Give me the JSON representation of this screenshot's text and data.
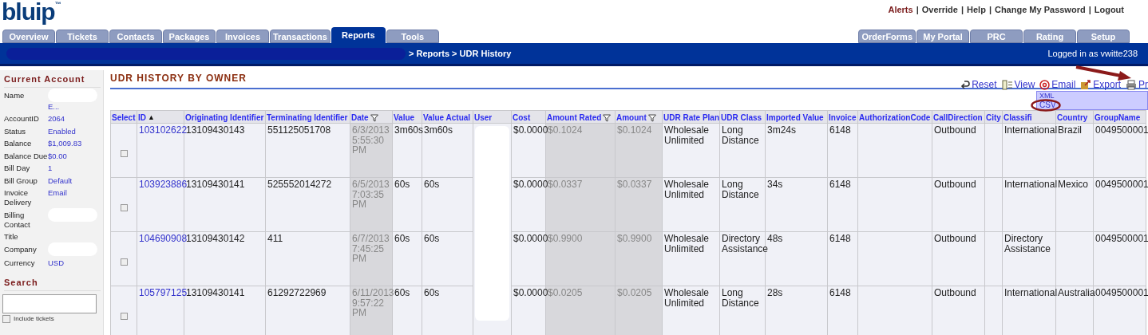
{
  "logo": {
    "text": "bluip",
    "tm": "™"
  },
  "top_links": {
    "separator": "|",
    "items": [
      "Alerts",
      "Override",
      "Help",
      "Change My Password",
      "Logout"
    ]
  },
  "tabs_left": [
    {
      "label": "Overview",
      "selected": false
    },
    {
      "label": "Tickets",
      "selected": false
    },
    {
      "label": "Contacts",
      "selected": false
    },
    {
      "label": "Packages",
      "selected": false
    },
    {
      "label": "Invoices",
      "selected": false
    },
    {
      "label": "Transactions",
      "selected": false
    },
    {
      "label": "Reports",
      "selected": true
    },
    {
      "label": "Tools",
      "selected": false
    }
  ],
  "tabs_right": [
    {
      "label": "OrderForms",
      "selected": false
    },
    {
      "label": "My Portal",
      "selected": false
    },
    {
      "label": "PRC",
      "selected": false
    },
    {
      "label": "Rating",
      "selected": false
    },
    {
      "label": "Setup",
      "selected": false
    }
  ],
  "breadcrumb": "> Reports > UDR History",
  "logged_in": "Logged in as vwitte238",
  "sidebar": {
    "title": "Current Account",
    "fields": [
      {
        "label": "Name",
        "value": "E...",
        "redacted": true
      },
      {
        "label": "AccountID",
        "value": "2064",
        "redacted": false
      },
      {
        "label": "Status",
        "value": "Enabled",
        "redacted": false
      },
      {
        "label": "Balance",
        "value": "$1,009.83",
        "redacted": false
      },
      {
        "label": "Balance Due",
        "value": "$0.00",
        "redacted": false
      },
      {
        "label": "Bill Day",
        "value": "1",
        "redacted": false
      },
      {
        "label": "Bill Group",
        "value": "Default",
        "redacted": false
      },
      {
        "label": "Invoice Delivery",
        "value": "Email",
        "redacted": false
      },
      {
        "label": "Billing Contact",
        "redacted": true
      },
      {
        "label": "Title",
        "redacted": false
      },
      {
        "label": "Company",
        "redacted": true
      },
      {
        "label": "Currency",
        "value": "USD",
        "redacted": false
      }
    ],
    "search_title": "Search",
    "include_label": "Include tickets",
    "include_checked": false
  },
  "page_title": "UDR HISTORY BY OWNER",
  "toolbar": [
    {
      "kind": "reset",
      "label": "Reset"
    },
    {
      "kind": "view",
      "label": "View"
    },
    {
      "kind": "email",
      "label": "Email"
    },
    {
      "kind": "export",
      "label": "Export"
    },
    {
      "kind": "print",
      "label": "Pr"
    }
  ],
  "export_menu": [
    "XML",
    "CSV"
  ],
  "table": {
    "columns": [
      {
        "label": "Select",
        "kind": "check"
      },
      {
        "label": "ID",
        "kind": "link",
        "sort": "▲"
      },
      {
        "label": "Originating Identifier",
        "kind": "text"
      },
      {
        "label": "Terminating Identifier",
        "kind": "text"
      },
      {
        "label": "Date",
        "kind": "shaded",
        "filter": true
      },
      {
        "label": "Value",
        "kind": "text"
      },
      {
        "label": "Value Actual",
        "kind": "text"
      },
      {
        "label": "User",
        "kind": "redacted"
      },
      {
        "label": "Cost",
        "kind": "text"
      },
      {
        "label": "Amount Rated",
        "kind": "shaded",
        "filter": true
      },
      {
        "label": "Amount",
        "kind": "shaded",
        "filter": true
      },
      {
        "label": "UDR Rate Plan",
        "kind": "text"
      },
      {
        "label": "UDR Class",
        "kind": "text"
      },
      {
        "label": "Imported Value",
        "kind": "text"
      },
      {
        "label": "Invoice",
        "kind": "text"
      },
      {
        "label": "AuthorizationCode",
        "kind": "text"
      },
      {
        "label": "CallDirection",
        "kind": "text"
      },
      {
        "label": "City",
        "kind": "text"
      },
      {
        "label": "Classifi",
        "kind": "text"
      },
      {
        "label": "Country",
        "kind": "text"
      },
      {
        "label": "GroupName",
        "kind": "text"
      }
    ],
    "rows": [
      {
        "selected": false,
        "cells": [
          "",
          "103102622",
          "13109430143",
          "551125051708",
          "6/3/2013 5:55:30 PM",
          "3m60s",
          "3m60s",
          "",
          "$0.0000",
          "$0.1024",
          "$0.1024",
          "Wholesale Unlimited",
          "Long Distance",
          "3m24s",
          "6148",
          "",
          "Outbound",
          "",
          "International",
          "Brazil",
          "0049500001"
        ]
      },
      {
        "selected": false,
        "cells": [
          "",
          "103923886",
          "13109430141",
          "525552014272",
          "6/5/2013 7:03:35 PM",
          "60s",
          "60s",
          "",
          "$0.0000",
          "$0.0337",
          "$0.0337",
          "Wholesale Unlimited",
          "Long Distance",
          "34s",
          "6148",
          "",
          "Outbound",
          "",
          "International",
          "Mexico",
          "0049500001"
        ]
      },
      {
        "selected": false,
        "cells": [
          "",
          "104690908",
          "13109430142",
          "411",
          "6/7/2013 7:45:25 PM",
          "60s",
          "60s",
          "",
          "$0.0000",
          "$0.9900",
          "$0.9900",
          "Wholesale Unlimited",
          "Directory Assistance",
          "48s",
          "6148",
          "",
          "Outbound",
          "",
          "Directory Assistance",
          "",
          "0049500001"
        ]
      },
      {
        "selected": false,
        "cells": [
          "",
          "105797125",
          "13109430141",
          "61292722969",
          "6/11/2013 9:57:22 PM",
          "60s",
          "60s",
          "",
          "$0.0000",
          "$0.0205",
          "$0.0205",
          "Wholesale Unlimited",
          "Long Distance",
          "28s",
          "6148",
          "",
          "Outbound",
          "",
          "International",
          "Australia",
          "0049500001"
        ]
      }
    ]
  }
}
